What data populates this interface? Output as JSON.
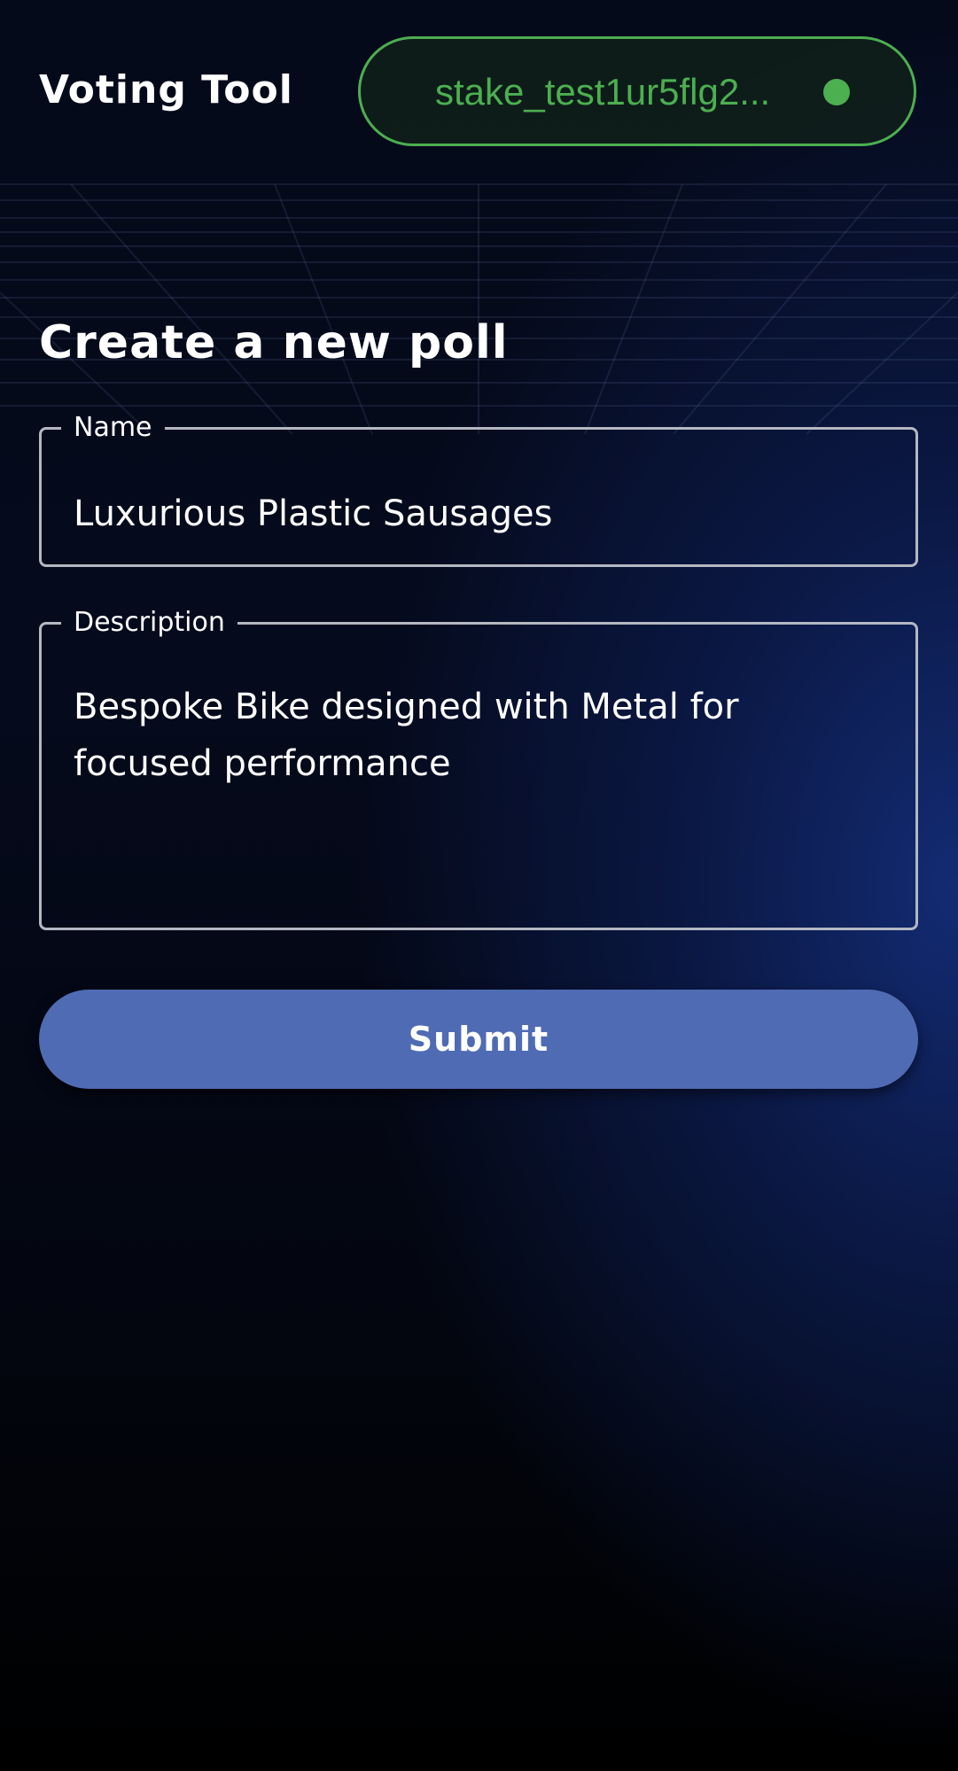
{
  "header": {
    "app_title": "Voting Tool",
    "wallet": {
      "address": "stake_test1ur5flg2...",
      "status_icon": "connected-status-dot",
      "status_color": "#4caf50"
    }
  },
  "main": {
    "title": "Create a new poll",
    "form": {
      "name": {
        "label": "Name",
        "value": "Luxurious Plastic Sausages"
      },
      "description": {
        "label": "Description",
        "value": "Bespoke Bike designed with Metal for focused performance"
      },
      "submit_label": "Submit"
    }
  },
  "colors": {
    "accent_green": "#4caf50",
    "submit_button": "#4f6bb4",
    "field_border": "#b3b8c2",
    "background_dark": "#050a1a",
    "background_glow": "#142d78"
  }
}
